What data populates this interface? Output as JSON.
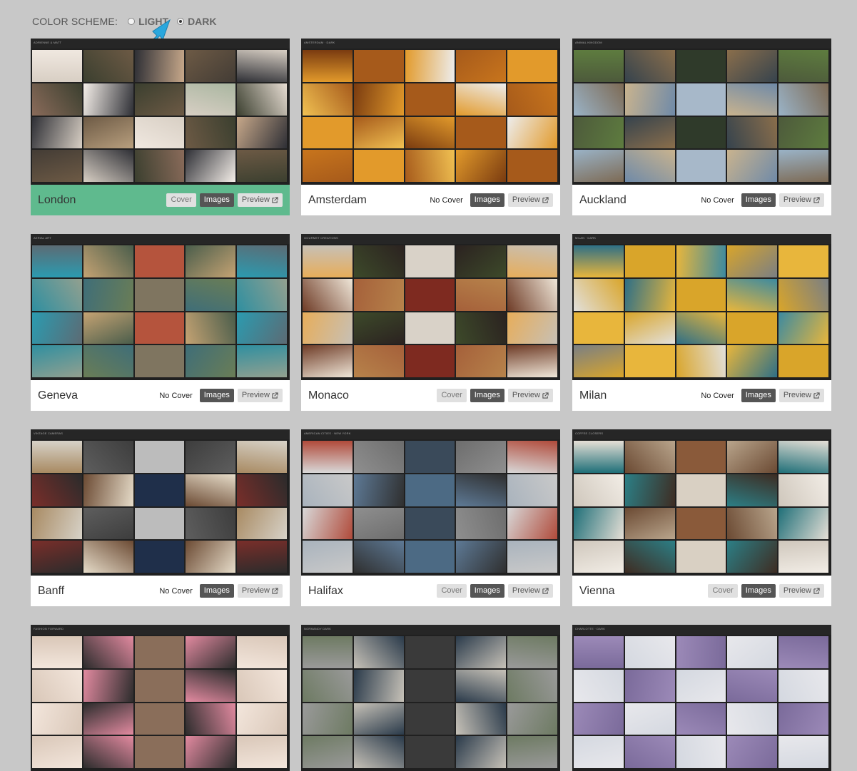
{
  "color_scheme": {
    "label": "COLOR SCHEME:",
    "options": [
      {
        "label": "LIGHT",
        "checked": false
      },
      {
        "label": "DARK",
        "checked": true
      }
    ]
  },
  "buttons": {
    "cover": "Cover",
    "no_cover": "No Cover",
    "images": "Images",
    "preview": "Preview"
  },
  "cards": [
    {
      "name": "London",
      "cover": "button",
      "active": true,
      "thumb_title": "ADRIENNE & MATT",
      "palette": [
        "#d8cfc4",
        "#8a6b5a",
        "#f0e8e0",
        "#3b3f2f",
        "#c7a88a",
        "#e6dcd2",
        "#2e2f35",
        "#b89f7e",
        "#f5efe9",
        "#6d5a45",
        "#a9b6a0",
        "#433c35"
      ]
    },
    {
      "name": "Amsterdam",
      "cover": "none",
      "active": false,
      "thumb_title": "AMSTERDAM · DARK",
      "palette": [
        "#c8751c",
        "#e29a2b",
        "#f1c152",
        "#7a3b10",
        "#a65a1b",
        "#ededed"
      ]
    },
    {
      "name": "Auckland",
      "cover": "none",
      "active": false,
      "thumb_title": "ANIMAL KINGDOM",
      "palette": [
        "#6f8aa8",
        "#8a6e4b",
        "#4d5a3b",
        "#a7b8c9",
        "#5e7c3f",
        "#36434d",
        "#c9b38e",
        "#7d6a54",
        "#2f3a2a",
        "#9ab3c7"
      ]
    },
    {
      "name": "Geneva",
      "cover": "none",
      "active": false,
      "thumb_title": "AERIAL ART",
      "palette": [
        "#2f8fa0",
        "#6a7d56",
        "#4a5d4b",
        "#2b9bb0",
        "#7f7560",
        "#5c6b74",
        "#c5a373",
        "#3f6e78",
        "#93a08f",
        "#b5543d"
      ]
    },
    {
      "name": "Monaco",
      "cover": "button",
      "active": false,
      "thumb_title": "GOURMET CREATIONS",
      "palette": [
        "#d9d2c8",
        "#6e3b26",
        "#b7834b",
        "#2b2220",
        "#e7ad5a",
        "#7e2a20",
        "#c7c0b5",
        "#3d4a2a",
        "#a5603a",
        "#efe6d8"
      ]
    },
    {
      "name": "Milan",
      "cover": "none",
      "active": false,
      "thumb_title": "MILAN · DARK",
      "palette": [
        "#e2e0dc",
        "#2e6f86",
        "#d9a52a",
        "#3c8aa0",
        "#7a7f84",
        "#e8b63c"
      ]
    },
    {
      "name": "Banff",
      "cover": "none",
      "active": false,
      "thumb_title": "VINTAGE CAMERAS",
      "palette": [
        "#6b4a33",
        "#2b2b2b",
        "#bcbcbc",
        "#7a2e2a",
        "#e6dcc9",
        "#3d3d3d",
        "#a88a62",
        "#1f2f4a",
        "#d7d2c8",
        "#5e5e5e"
      ]
    },
    {
      "name": "Halifax",
      "cover": "button",
      "active": false,
      "thumb_title": "AMERICAN CITIES · NEW YORK",
      "palette": [
        "#8f8f8f",
        "#5e7a96",
        "#c9c9c9",
        "#3a4a5a",
        "#a9b3bd",
        "#2f2f2f",
        "#6d6d6d",
        "#d8d8d8",
        "#4c6a84",
        "#b04a3a"
      ]
    },
    {
      "name": "Vienna",
      "cover": "button",
      "active": false,
      "thumb_title": "COFFEE CLOSERS",
      "palette": [
        "#e6dfd6",
        "#6b4a33",
        "#2c7f86",
        "#f2ede6",
        "#8a5a3a",
        "#cfc7bc",
        "#3e2c22",
        "#b9a58c",
        "#1f6f78",
        "#d9d0c3"
      ]
    },
    {
      "name": "",
      "cover": "none",
      "active": false,
      "thumb_title": "FASHION FORWARD",
      "palette": [
        "#8a6e5a",
        "#d9c7b8",
        "#2c2c2c",
        "#e28aa0",
        "#f3e6dc"
      ]
    },
    {
      "name": "",
      "cover": "none",
      "active": false,
      "thumb_title": "NORMANDY DARK",
      "palette": [
        "#9a9a9a",
        "#3a3a3a",
        "#6d7a62",
        "#c7c2b8",
        "#2a3a4a"
      ]
    },
    {
      "name": "",
      "cover": "none",
      "active": false,
      "thumb_title": "CHARLOTTE · DARK",
      "palette": [
        "#e8e8ec",
        "#9c8ab8",
        "#d4d8e0",
        "#7a6a9a"
      ]
    }
  ]
}
